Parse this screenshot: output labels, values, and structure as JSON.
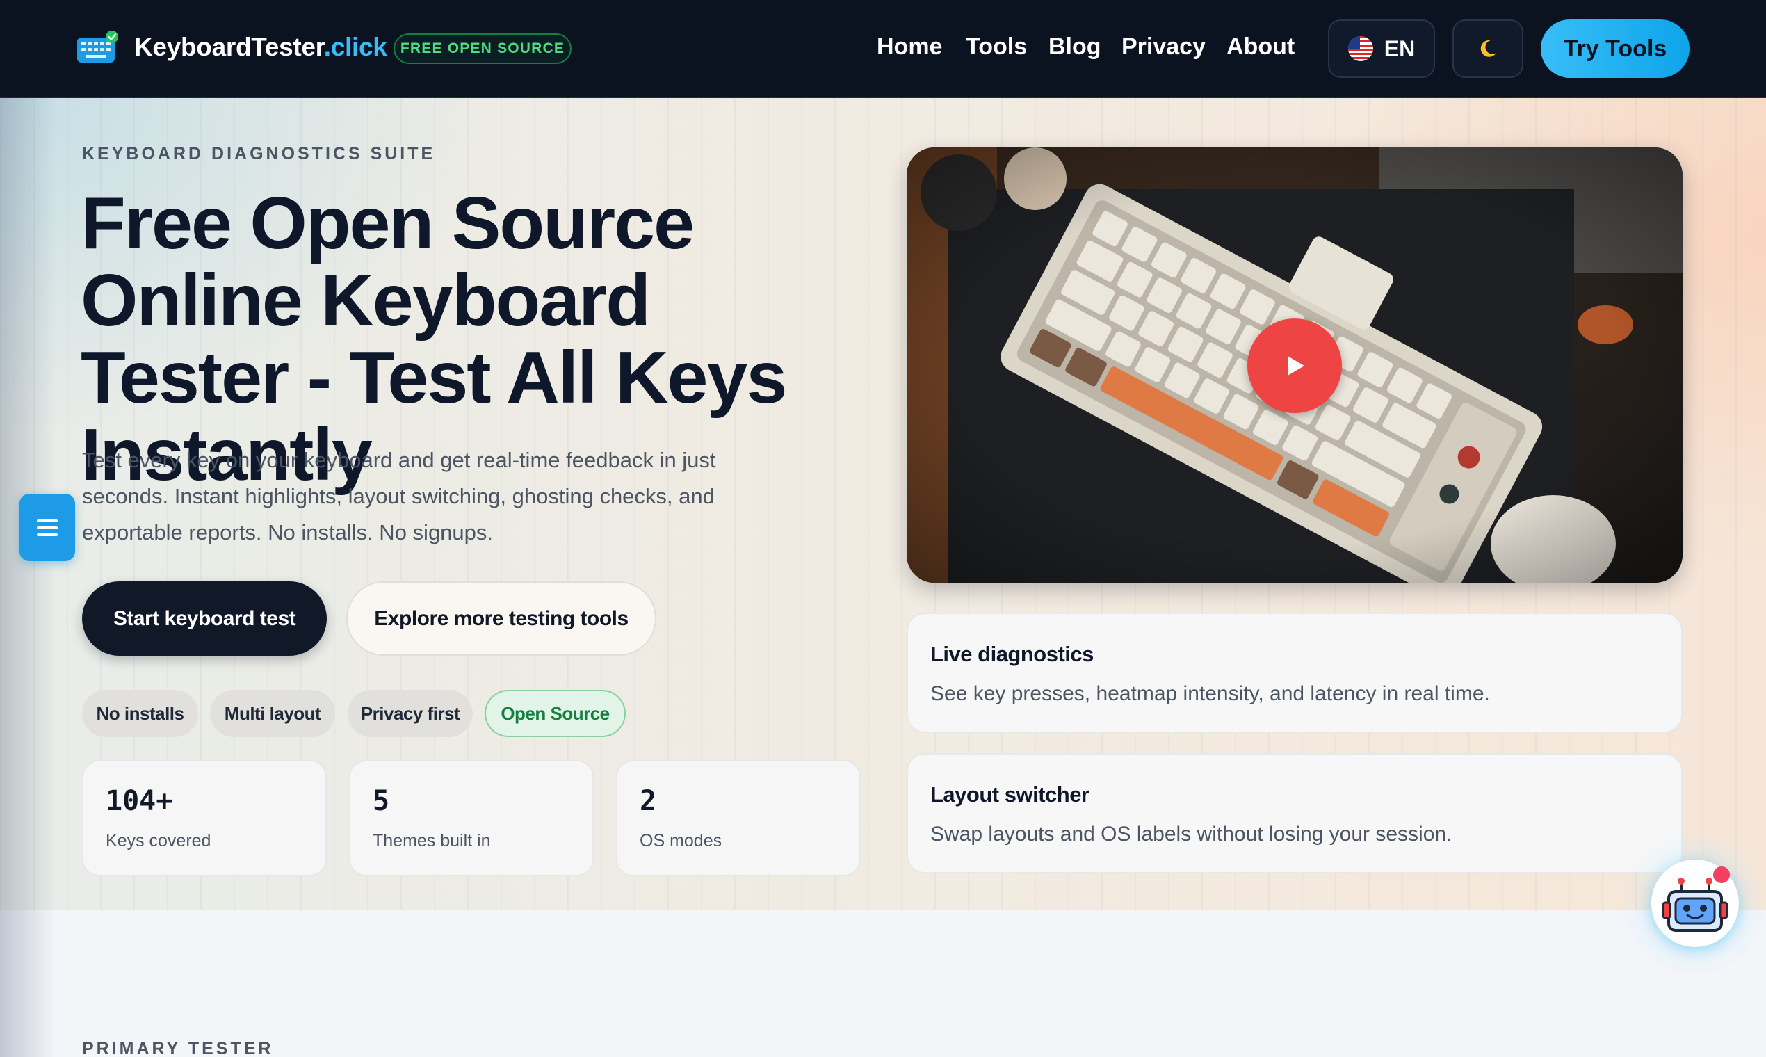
{
  "header": {
    "brand_main": "KeyboardTester",
    "brand_tld": ".click",
    "badge": "FREE OPEN SOURCE",
    "nav": [
      "Home",
      "Tools",
      "Blog",
      "Privacy",
      "About"
    ],
    "language": "EN",
    "language_icon": "us-flag-icon",
    "theme_icon": "moon-icon",
    "cta": "Try Tools"
  },
  "hero": {
    "eyebrow": "KEYBOARD DIAGNOSTICS SUITE",
    "headline": "Free Open Source Online Keyboard Tester - Test All Keys Instantly",
    "lede": "Test every key on your keyboard and get real-time feedback in just seconds. Instant highlights, layout switching, ghosting checks, and exportable reports. No installs. No signups.",
    "primary_button": "Start keyboard test",
    "secondary_button": "Explore more testing tools",
    "chips": [
      "No installs",
      "Multi layout",
      "Privacy first",
      "Open Source"
    ],
    "stats": [
      {
        "value": "104+",
        "label": "Keys covered"
      },
      {
        "value": "5",
        "label": "Themes built in"
      },
      {
        "value": "2",
        "label": "OS modes"
      }
    ]
  },
  "features": [
    {
      "title": "Live diagnostics",
      "description": "See key presses, heatmap intensity, and latency in real time."
    },
    {
      "title": "Layout switcher",
      "description": "Swap layouts and OS labels without losing your session."
    }
  ],
  "next_section": {
    "eyebrow": "PRIMARY TESTER"
  },
  "colors": {
    "header_bg": "#0b1220",
    "accent": "#38bdf8",
    "badge_green": "#4ade80",
    "play_red": "#ef4444",
    "primary_button": "#111827"
  }
}
